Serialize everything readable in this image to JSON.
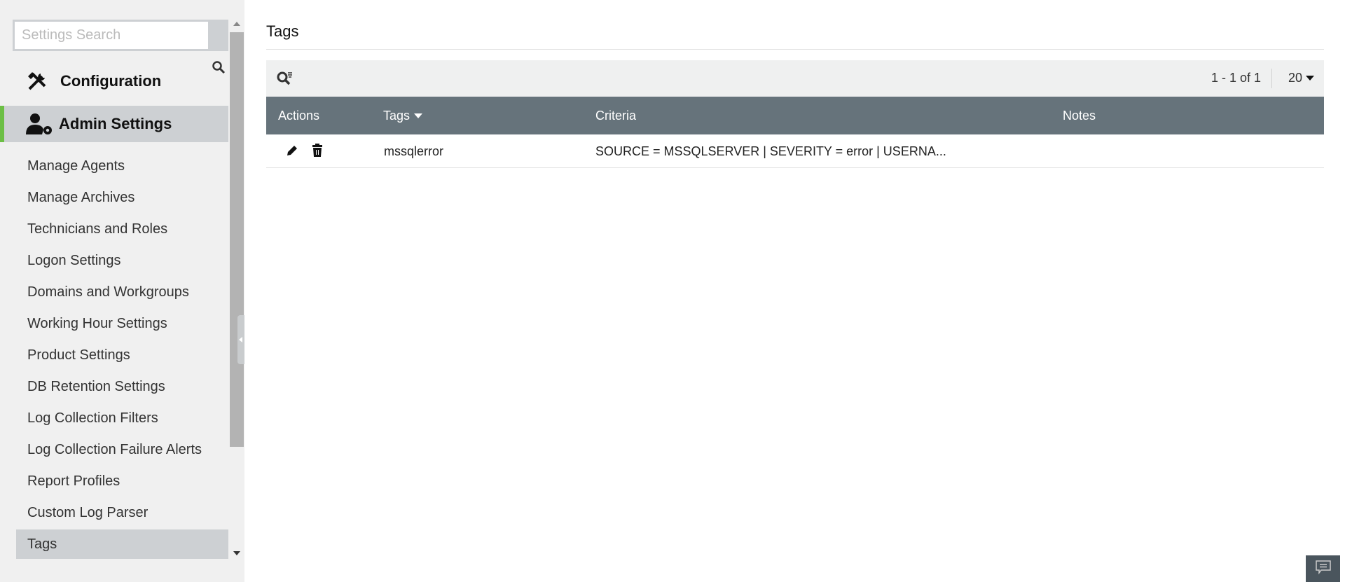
{
  "sidebar": {
    "search_placeholder": "Settings Search",
    "categories": [
      {
        "label": "Configuration",
        "icon": "tools-icon"
      },
      {
        "label": "Admin Settings",
        "icon": "admin-user-gear-icon"
      }
    ],
    "items": [
      {
        "label": "Manage Agents"
      },
      {
        "label": "Manage Archives"
      },
      {
        "label": "Technicians and Roles"
      },
      {
        "label": "Logon Settings"
      },
      {
        "label": "Domains and Workgroups"
      },
      {
        "label": "Working Hour Settings"
      },
      {
        "label": "Product Settings"
      },
      {
        "label": "DB Retention Settings"
      },
      {
        "label": "Log Collection Filters"
      },
      {
        "label": "Log Collection Failure Alerts"
      },
      {
        "label": "Report Profiles"
      },
      {
        "label": "Custom Log Parser"
      },
      {
        "label": "Tags",
        "active": true
      }
    ]
  },
  "main": {
    "title": "Tags",
    "pager": "1 - 1 of 1",
    "per_page": "20",
    "columns": [
      "Actions",
      "Tags",
      "Criteria",
      "Notes"
    ],
    "rows": [
      {
        "tag": "mssqlerror",
        "criteria": "SOURCE = MSSQLSERVER | SEVERITY = error | USERNA...",
        "notes": ""
      }
    ]
  },
  "colors": {
    "accent": "#6cbf45",
    "header": "#66737b"
  }
}
